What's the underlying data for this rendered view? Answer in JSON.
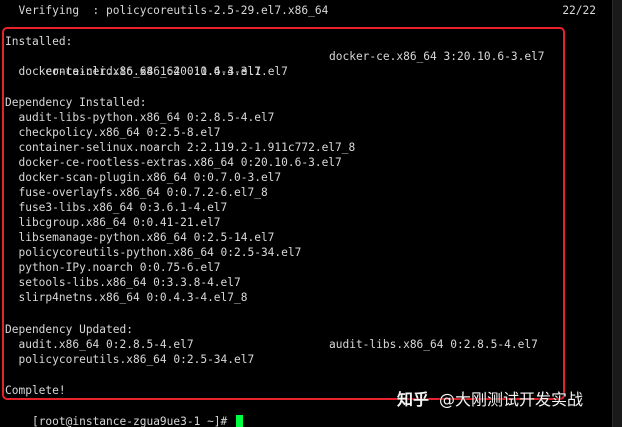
{
  "top": {
    "verifying": "  Verifying  : policycoreutils-2.5-29.el7.x86_64",
    "count": "22/22"
  },
  "installed": {
    "header": "Installed:",
    "row1_col1": "  containerd.io.x86_64 0:1.4.4-3.1.el7",
    "row1_col2": "docker-ce.x86_64 3:20.10.6-3.el7",
    "row2": "  docker-ce-cli.x86_64 1:20.10.6-3.el7"
  },
  "dependency_installed": {
    "header": "Dependency Installed:",
    "items": [
      "  audit-libs-python.x86_64 0:2.8.5-4.el7",
      "  checkpolicy.x86_64 0:2.5-8.el7",
      "  container-selinux.noarch 2:2.119.2-1.911c772.el7_8",
      "  docker-ce-rootless-extras.x86_64 0:20.10.6-3.el7",
      "  docker-scan-plugin.x86_64 0:0.7.0-3.el7",
      "  fuse-overlayfs.x86_64 0:0.7.2-6.el7_8",
      "  fuse3-libs.x86_64 0:3.6.1-4.el7",
      "  libcgroup.x86_64 0:0.41-21.el7",
      "  libsemanage-python.x86_64 0:2.5-14.el7",
      "  policycoreutils-python.x86_64 0:2.5-34.el7",
      "  python-IPy.noarch 0:0.75-6.el7",
      "  setools-libs.x86_64 0:3.3.8-4.el7",
      "  slirp4netns.x86_64 0:0.4.3-4.el7_8"
    ]
  },
  "dependency_updated": {
    "header": "Dependency Updated:",
    "row1_col1": "  audit.x86_64 0:2.8.5-4.el7",
    "row1_col2": "audit-libs.x86_64 0:2.8.5-4.el7",
    "row2": "  policycoreutils.x86_64 0:2.5-34.el7"
  },
  "complete": "Complete!",
  "prompt": "[root@instance-zgua9ue3-1 ~]# ",
  "watermark": {
    "brand": "知乎",
    "author": "@大刚测试开发实战"
  },
  "colors": {
    "highlight_box": "#e8222a",
    "cursor": "#00ff40",
    "background": "#000000",
    "text": "#d8d8d8"
  }
}
